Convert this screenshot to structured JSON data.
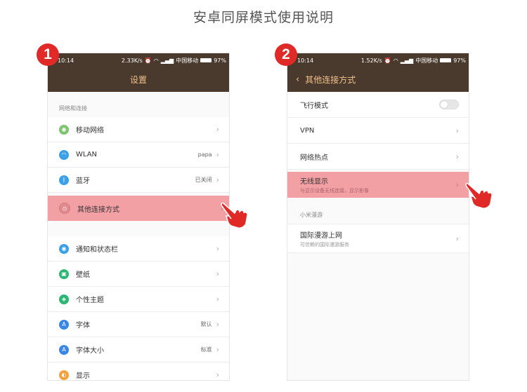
{
  "page_title": "安卓同屏模式使用说明",
  "step1_number": "1",
  "step2_number": "2",
  "status_bar_1": {
    "time": "10:14",
    "speed": "2.33K/s",
    "carrier": "中国移动",
    "battery": "97%"
  },
  "status_bar_2": {
    "time": "10:14",
    "speed": "1.52K/s",
    "carrier": "中国移动",
    "battery": "97%"
  },
  "phone1": {
    "title": "设置",
    "section_network": "网络和连接",
    "items": [
      {
        "label": "移动网络",
        "value": "",
        "icon_color": "#7cc46e"
      },
      {
        "label": "WLAN",
        "value": "papa",
        "icon_color": "#3aa0e8"
      },
      {
        "label": "蓝牙",
        "value": "已关闭",
        "icon_color": "#3aa0e8"
      },
      {
        "label": "其他连接方式",
        "value": "",
        "icon_color": "#e28a8e"
      },
      {
        "label": "通知和状态栏",
        "value": "",
        "icon_color": "#3aa0e8"
      },
      {
        "label": "壁纸",
        "value": "",
        "icon_color": "#2bb673"
      },
      {
        "label": "个性主题",
        "value": "",
        "icon_color": "#2bb673"
      },
      {
        "label": "字体",
        "value": "默认",
        "icon_color": "#3a86e8"
      },
      {
        "label": "字体大小",
        "value": "标准",
        "icon_color": "#3a86e8"
      },
      {
        "label": "显示",
        "value": "",
        "icon_color": "#f3a13a"
      }
    ]
  },
  "phone2": {
    "title": "其他连接方式",
    "items": [
      {
        "label": "飞行模式"
      },
      {
        "label": "VPN"
      },
      {
        "label": "网络热点"
      },
      {
        "label": "无线显示",
        "sub": "与显示设备无线连接，显示影像"
      }
    ],
    "section_roaming": "小米漫游",
    "roaming": {
      "label": "国际漫游上网",
      "sub": "可信赖的国际漫游服务"
    }
  }
}
